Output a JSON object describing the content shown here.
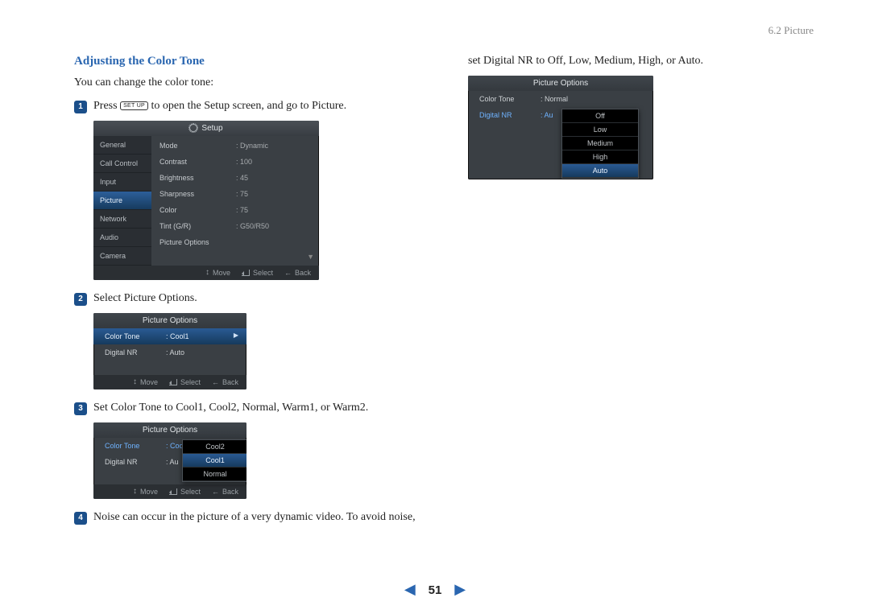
{
  "section_ref": "6.2 Picture",
  "heading": "Adjusting the Color Tone",
  "intro": "You can change the color tone:",
  "steps": {
    "s1": {
      "num": "1",
      "pre": "Press ",
      "key": "SET UP",
      "post": " to open the Setup screen, and go to Picture."
    },
    "s2": {
      "num": "2",
      "text": "Select Picture Options."
    },
    "s3": {
      "num": "3",
      "text": "Set Color Tone to Cool1, Cool2, Normal, Warm1, or Warm2."
    },
    "s4": {
      "num": "4",
      "text": "Noise can occur in the picture of a very dynamic video. To avoid noise,"
    }
  },
  "col2_lead": "set Digital NR to Off, Low, Medium, High, or Auto.",
  "setup_panel": {
    "title": "Setup",
    "sidebar": [
      "General",
      "Call Control",
      "Input",
      "Picture",
      "Network",
      "Audio",
      "Camera"
    ],
    "selected": "Picture",
    "rows": [
      {
        "lab": "Mode",
        "val": "Dynamic"
      },
      {
        "lab": "Contrast",
        "val": "100"
      },
      {
        "lab": "Brightness",
        "val": "45"
      },
      {
        "lab": "Sharpness",
        "val": "75"
      },
      {
        "lab": "Color",
        "val": "75"
      },
      {
        "lab": "Tint (G/R)",
        "val": "G50/R50"
      },
      {
        "lab": "Picture Options",
        "val": ""
      }
    ],
    "footer": {
      "move": "Move",
      "select": "Select",
      "back": "Back"
    }
  },
  "pic_opts_panel": {
    "title": "Picture Options",
    "rows": [
      {
        "lab": "Color Tone",
        "val": "Cool1",
        "sel": true
      },
      {
        "lab": "Digital NR",
        "val": "Auto",
        "sel": false
      }
    ],
    "footer": {
      "move": "Move",
      "select": "Select",
      "back": "Back"
    }
  },
  "color_tone_panel": {
    "title": "Picture Options",
    "rows": [
      {
        "lab": "Color Tone",
        "val": "Coo",
        "hl": true
      },
      {
        "lab": "Digital NR",
        "val": "Au"
      }
    ],
    "dropdown": {
      "items": [
        "Cool2",
        "Cool1",
        "Normal"
      ],
      "selected": "Cool1"
    },
    "footer": {
      "move": "Move",
      "select": "Select",
      "back": "Back"
    }
  },
  "digital_nr_panel": {
    "title": "Picture Options",
    "rows": [
      {
        "lab": "Color Tone",
        "val": "Normal"
      },
      {
        "lab": "Digital NR",
        "val": "Au",
        "hl": true
      }
    ],
    "dropdown": {
      "items": [
        "Off",
        "Low",
        "Medium",
        "High",
        "Auto"
      ],
      "selected": "Auto"
    }
  },
  "footer_sym": {
    "updown": "↕"
  },
  "pager": {
    "page": "51"
  }
}
